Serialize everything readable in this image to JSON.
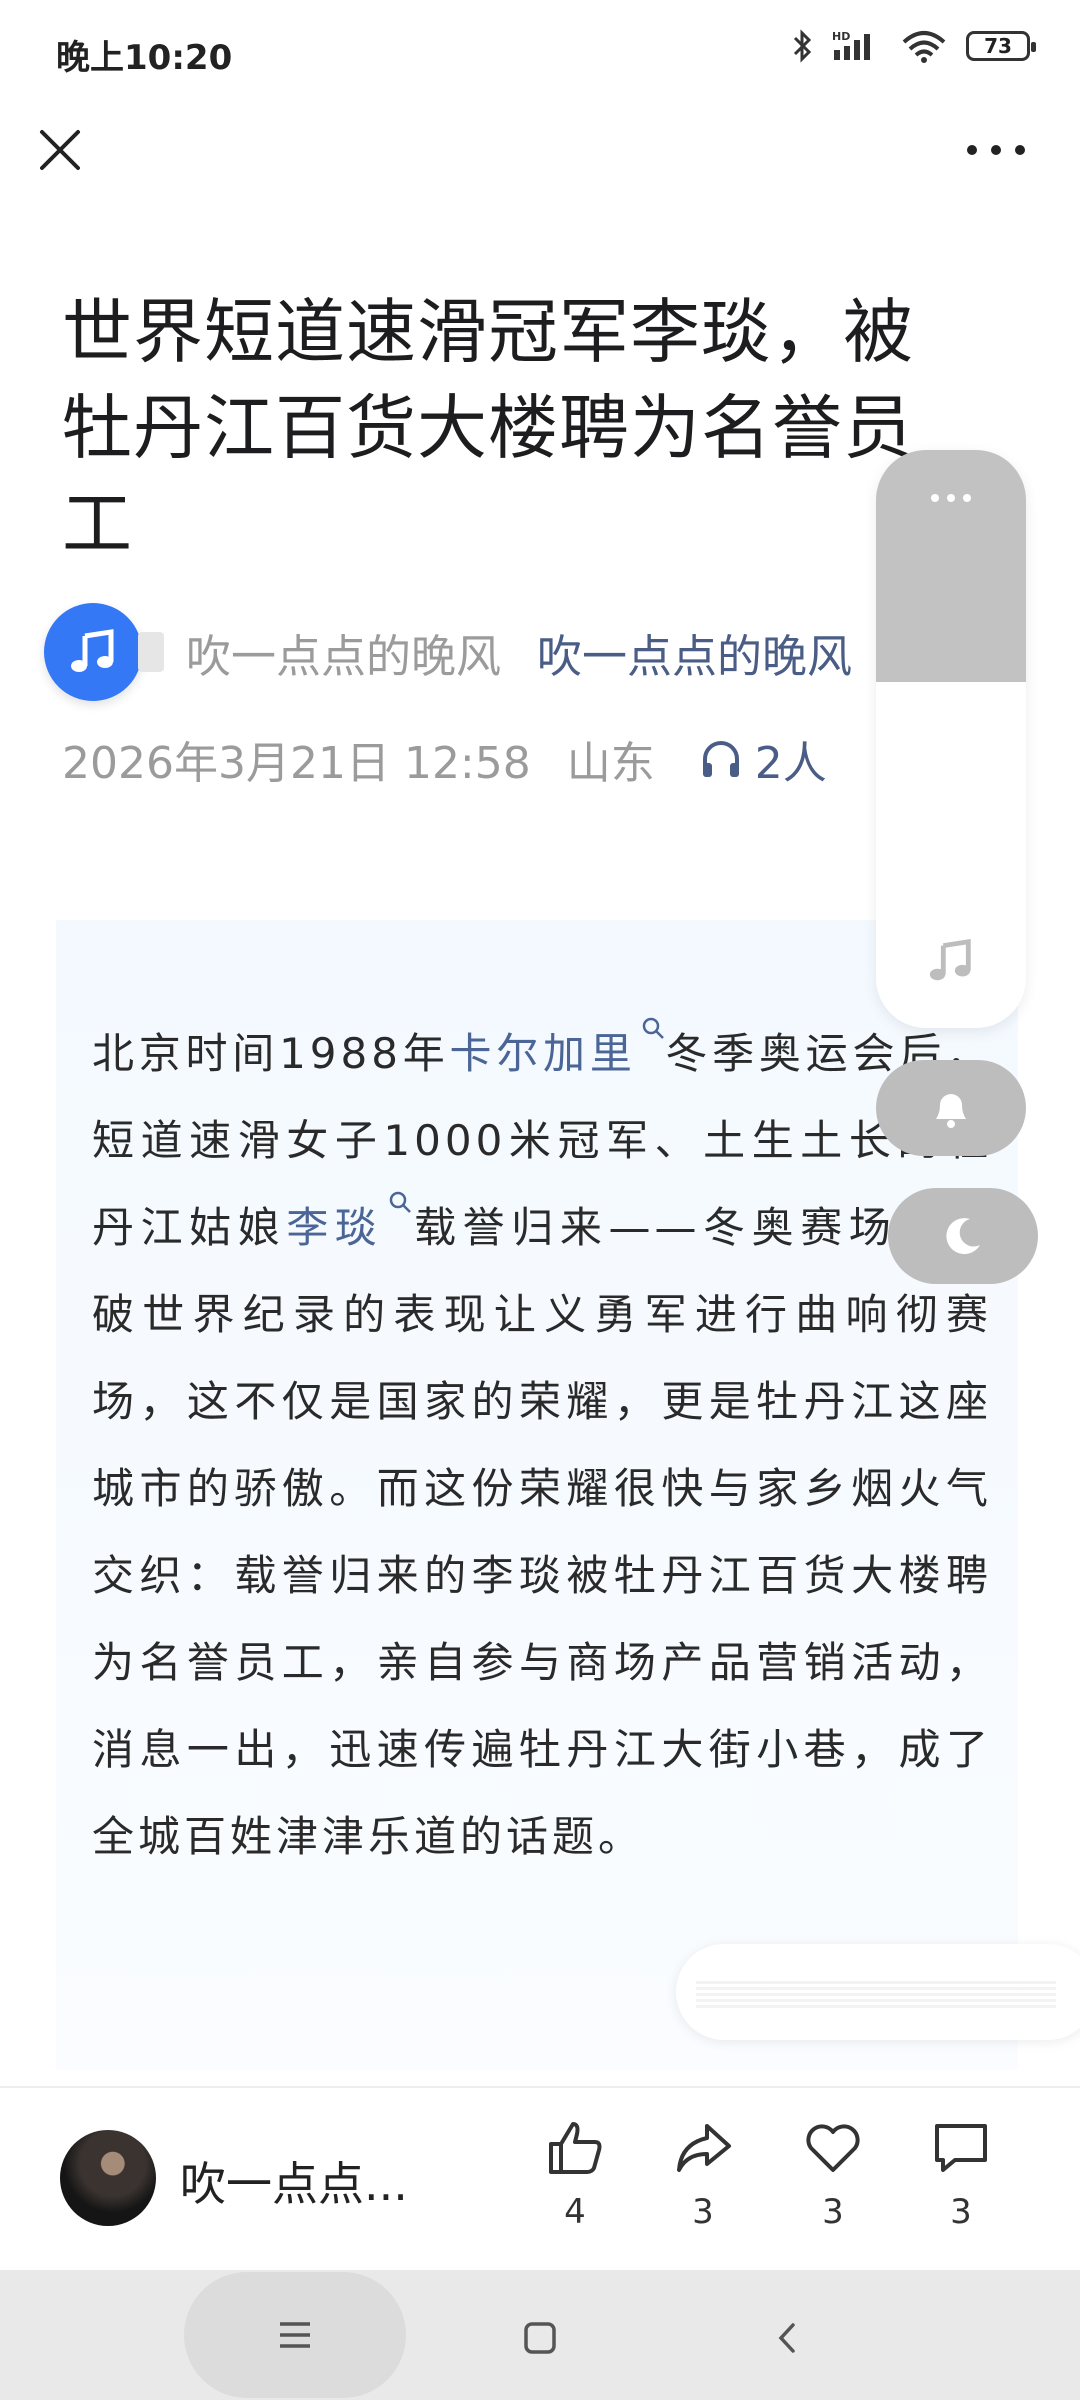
{
  "status_bar": {
    "time": "晚上10:20",
    "battery": "73"
  },
  "article": {
    "title": "世界短道速滑冠军李琰，被牡丹江百货大楼聘为名誉员工",
    "author_plain": "吹一点点的晚风",
    "author_link": "吹一点点的晚风",
    "date": "2026年3月21日 12:58",
    "location": "山东",
    "listeners": "2人",
    "body_segments": [
      {
        "text": "北京时间1988年"
      },
      {
        "text": "卡尔加里",
        "link": true
      },
      {
        "text": "冬季奥运会后，短道速滑女子1000米冠军、土生土长的牡丹江姑娘"
      },
      {
        "text": "李琰",
        "link": true
      },
      {
        "text": "载誉归来——冬奥赛场以打破世界纪录的表现让义勇军进行曲响彻赛场，这不仅是国家的荣耀，更是牡丹江这座城市的骄傲。而这份荣耀很快与家乡烟火气交织：载誉归来的李琰被牡丹江百货大楼聘为名誉员工，亲自参与商场产品营销活动，消息一出，迅速传遍牡丹江大街小巷，成了全城百姓津津乐道的话题。"
      }
    ]
  },
  "bottom_bar": {
    "user_name": "吹一点点...",
    "likes": "4",
    "shares": "3",
    "favorites": "3",
    "comments": "3"
  },
  "colors": {
    "accent_blue": "#3478f6",
    "link_text": "#4a6596",
    "card_bg": "#f4f9ff"
  }
}
